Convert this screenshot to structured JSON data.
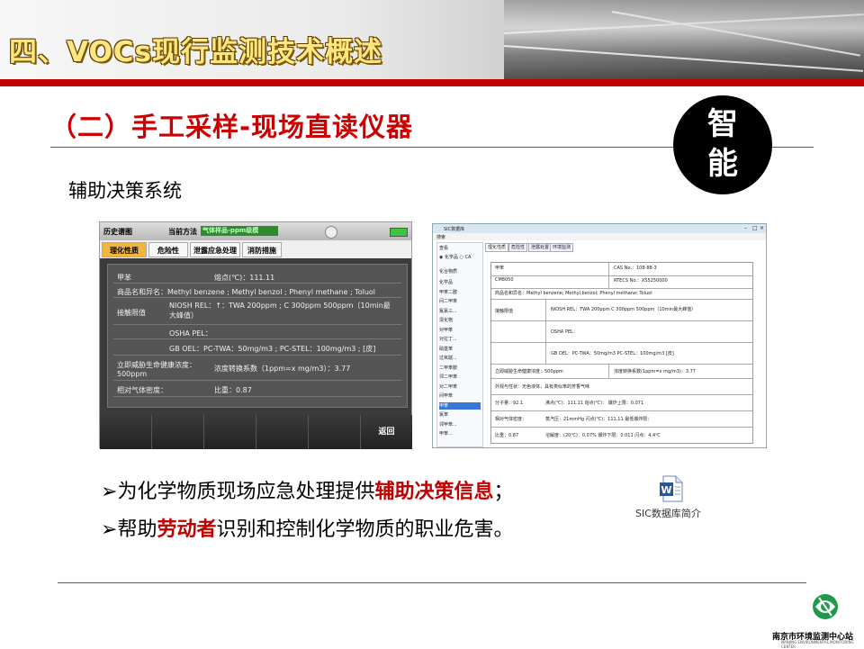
{
  "header": {
    "title_prefix": "四、",
    "title_main": "VOCs现行监测技术概述"
  },
  "subtitle": "（二）手工采样-现场直读仪器",
  "badge": {
    "line1": "智",
    "line2": "能"
  },
  "section_title": "辅助决策系统",
  "device": {
    "history_label": "历史谱图",
    "method_label": "当前方法",
    "method_value": "气体样品-ppm级模",
    "tabs": [
      "理化性质",
      "危险性",
      "泄露应急处理",
      "消防措施"
    ],
    "rows": [
      {
        "label": "甲苯",
        "value": "熔点(℃)：111.11"
      },
      {
        "label": "商品名和异名：Methyl benzene ; Methyl benzol ; Phenyl methane ; Toluol",
        "value": ""
      },
      {
        "label": "接触限值",
        "value": "NIOSH REL：↑：TWA 200ppm ; C 300ppm 500ppm（10min最大峰值）"
      },
      {
        "label": "",
        "value": "OSHA PEL："
      },
      {
        "label": "",
        "value": "GB OEL：PC-TWA：50mg/m3 ; PC-STEL：100mg/m3 ; [皮]"
      },
      {
        "label": "立即威胁生命健康浓度：500ppm",
        "value": "浓度转换系数（1ppm=x mg/m3）：3.77"
      },
      {
        "label": "相对气体密度：",
        "value": "比重：0.87"
      }
    ],
    "back_label": "返回"
  },
  "window": {
    "title": "SIC数据库",
    "menu": "搜索",
    "side_header": "查看",
    "side_radio": "化学品",
    "side_group": "化合物质",
    "side_items": [
      "化学品",
      "甲苯二胺",
      "间二甲苯",
      "氟氯三...",
      "溴化物",
      "对甲苯",
      "对拉丁...",
      "硝基苯",
      "过氧醚...",
      "二甲苯胺",
      "邻二甲苯",
      "对二甲苯",
      "间甲苯",
      "甲苯",
      "氯苯",
      "邻甲苯...",
      "甲苯..."
    ],
    "side_selected_index": 13,
    "tabs": [
      "理化性质",
      "危险性",
      "泄露处置",
      "环境监测"
    ],
    "rows": [
      {
        "a": "甲苯",
        "b": "CAS No.：108-88-3"
      },
      {
        "a": "CM8050",
        "b": "RTECS No.：XS5250000"
      },
      {
        "a": "商品名和异名：Methyl benzene; Methyl benzol; Phenyl methane; Toluol",
        "b": ""
      },
      {
        "a": "接触限值",
        "b": "NIOSH REL：TWA 200ppm C 300ppm 500ppm（10min最大峰值）"
      },
      {
        "a": "",
        "b": "OSHA PEL："
      },
      {
        "a": "",
        "b": "GB OEL：PC-TWA：50mg/m3 PC-STEL：100mg/m3 [皮]"
      },
      {
        "a": "立即威胁生命健康浓度：500ppm",
        "b": "浓度转换系数(1ppm=x mg/m3)：3.77"
      },
      {
        "a": "外观与性状：无色液体，具有类似苯的芳香气味",
        "b": ""
      },
      {
        "a": "分子量：92.1",
        "b": "沸点(℃)：111.11  熔点(℃)：  爆炸上限：0.071"
      },
      {
        "a": "相对气体密度：",
        "b": "蒸汽压：21mmHg  闪点(℃)：111.11  最低爆炸限："
      },
      {
        "a": "比重：0.87",
        "b": "溶解度：(20℃)：0.07%  爆炸下限：0.011  闪点：4.4℃"
      }
    ]
  },
  "bullets": [
    {
      "arrow": "➢",
      "pre": "为化学物质现场应急处理提供",
      "hl": "辅助决策信息",
      "post": "；"
    },
    {
      "arrow": "➢",
      "pre": "帮助",
      "hl": "劳动者",
      "post": "识别和控制化学物质的职业危害。"
    }
  ],
  "attachment": {
    "icon": "word-doc-icon",
    "label": "SIC数据库简介"
  },
  "org": {
    "name": "南京市环境监测中心站",
    "name_en": "NANJING ENVIRONMENTAL MONITORING CENTER"
  },
  "colors": {
    "accent_red": "#c00000",
    "tab_active": "#f2b640",
    "method_green": "#2e8b2e"
  }
}
